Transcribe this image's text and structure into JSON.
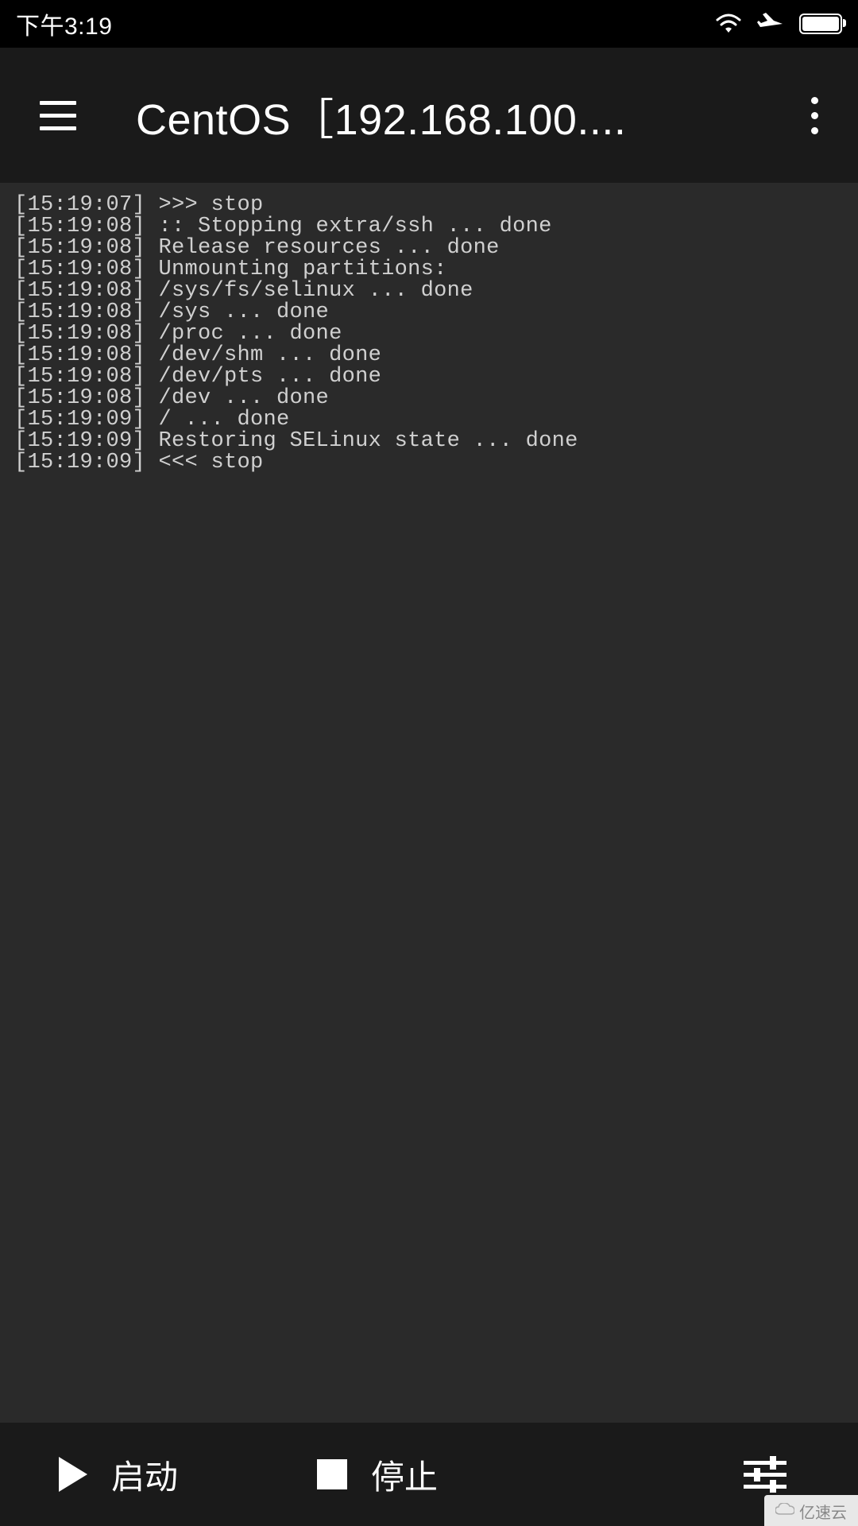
{
  "status_bar": {
    "time": "下午3:19"
  },
  "toolbar": {
    "title": "CentOS［192.168.100...."
  },
  "terminal": {
    "lines": [
      "[15:19:07] >>> stop",
      "[15:19:08] :: Stopping extra/ssh ... done",
      "[15:19:08] Release resources ... done",
      "[15:19:08] Unmounting partitions:",
      "[15:19:08] /sys/fs/selinux ... done",
      "[15:19:08] /sys ... done",
      "[15:19:08] /proc ... done",
      "[15:19:08] /dev/shm ... done",
      "[15:19:08] /dev/pts ... done",
      "[15:19:08] /dev ... done",
      "[15:19:09] / ... done",
      "[15:19:09] Restoring SELinux state ... done",
      "[15:19:09] <<< stop"
    ]
  },
  "bottom_toolbar": {
    "start_label": "启动",
    "stop_label": "停止"
  },
  "watermark": {
    "text": "亿速云"
  }
}
